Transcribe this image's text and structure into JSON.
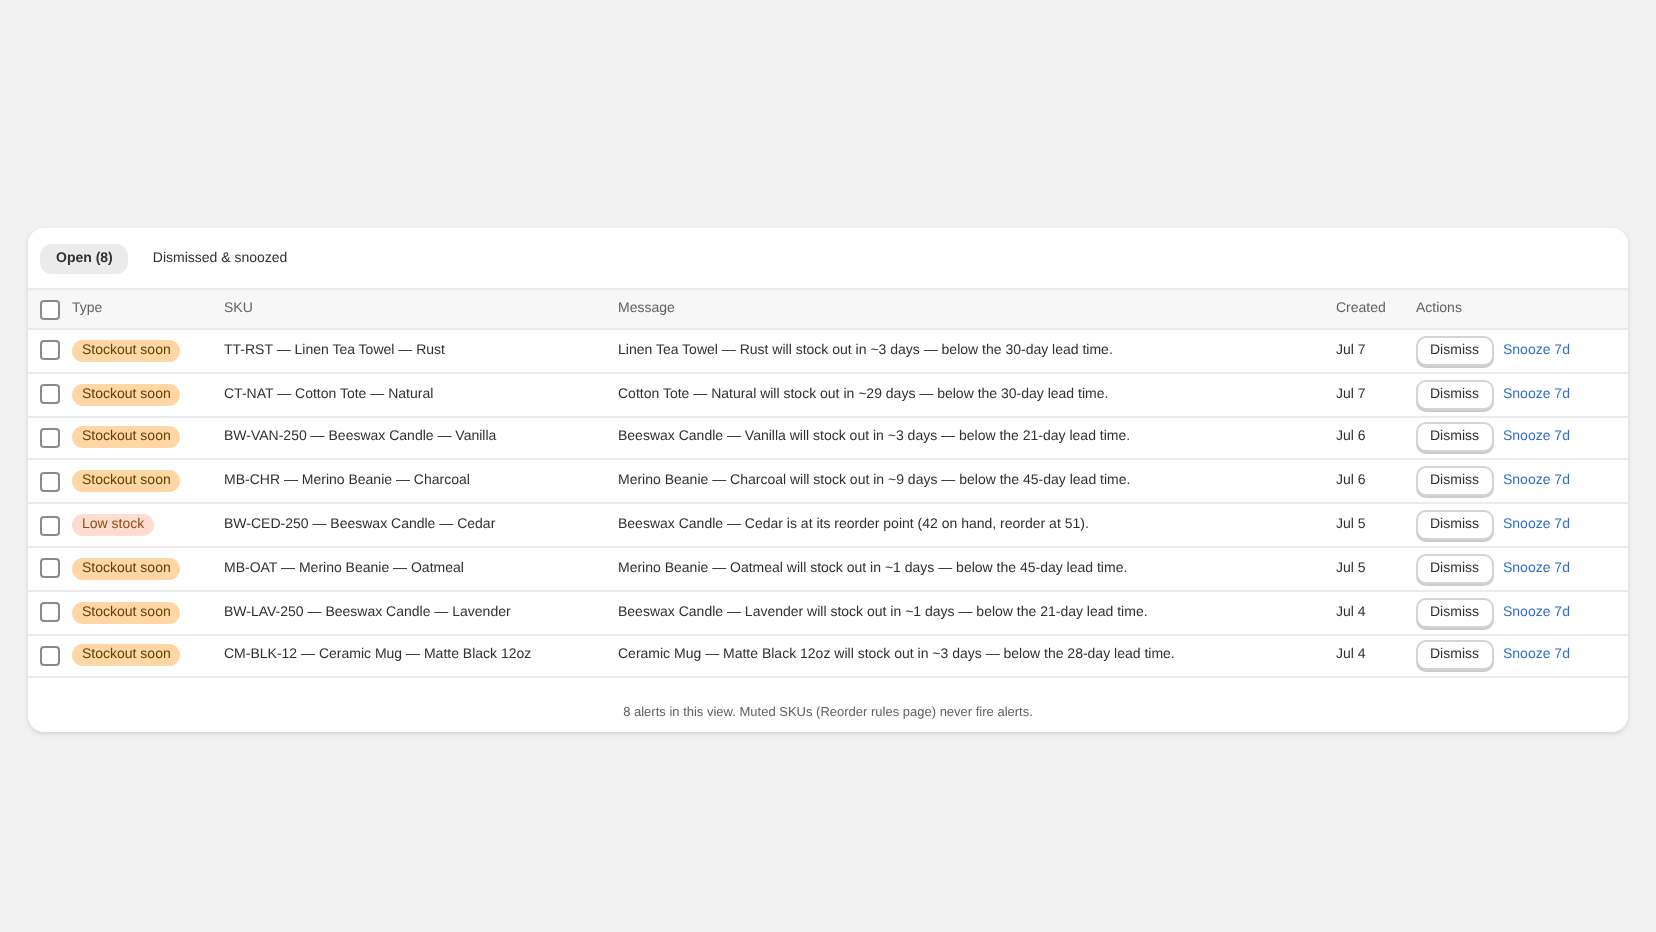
{
  "tabs": [
    {
      "label": "Open (8)",
      "selected": true
    },
    {
      "label": "Dismissed & snoozed",
      "selected": false
    }
  ],
  "table": {
    "select_all_checked": false,
    "columns": [
      "Type",
      "SKU",
      "Message",
      "Created",
      "Actions"
    ],
    "rows": [
      {
        "checked": false,
        "type": {
          "label": "Stockout soon",
          "kind": "stockout"
        },
        "sku": "TT-RST — Linen Tea Towel — Rust",
        "message": "Linen Tea Towel — Rust will stock out in ~3 days — below the 30-day lead time.",
        "created": "Jul 7",
        "actions": [
          "Dismiss",
          "Snooze 7d"
        ]
      },
      {
        "checked": false,
        "type": {
          "label": "Stockout soon",
          "kind": "stockout"
        },
        "sku": "CT-NAT — Cotton Tote — Natural",
        "message": "Cotton Tote — Natural will stock out in ~29 days — below the 30-day lead time.",
        "created": "Jul 7",
        "actions": [
          "Dismiss",
          "Snooze 7d"
        ]
      },
      {
        "checked": false,
        "type": {
          "label": "Stockout soon",
          "kind": "stockout"
        },
        "sku": "BW-VAN-250 — Beeswax Candle — Vanilla",
        "message": "Beeswax Candle — Vanilla will stock out in ~3 days — below the 21-day lead time.",
        "created": "Jul 6",
        "actions": [
          "Dismiss",
          "Snooze 7d"
        ]
      },
      {
        "checked": false,
        "type": {
          "label": "Stockout soon",
          "kind": "stockout"
        },
        "sku": "MB-CHR — Merino Beanie — Charcoal",
        "message": "Merino Beanie — Charcoal will stock out in ~9 days — below the 45-day lead time.",
        "created": "Jul 6",
        "actions": [
          "Dismiss",
          "Snooze 7d"
        ]
      },
      {
        "checked": false,
        "type": {
          "label": "Low stock",
          "kind": "low"
        },
        "sku": "BW-CED-250 — Beeswax Candle — Cedar",
        "message": "Beeswax Candle — Cedar is at its reorder point (42 on hand, reorder at 51).",
        "created": "Jul 5",
        "actions": [
          "Dismiss",
          "Snooze 7d"
        ]
      },
      {
        "checked": false,
        "type": {
          "label": "Stockout soon",
          "kind": "stockout"
        },
        "sku": "MB-OAT — Merino Beanie — Oatmeal",
        "message": "Merino Beanie — Oatmeal will stock out in ~1 days — below the 45-day lead time.",
        "created": "Jul 5",
        "actions": [
          "Dismiss",
          "Snooze 7d"
        ]
      },
      {
        "checked": false,
        "type": {
          "label": "Stockout soon",
          "kind": "stockout"
        },
        "sku": "BW-LAV-250 — Beeswax Candle — Lavender",
        "message": "Beeswax Candle — Lavender will stock out in ~1 days — below the 21-day lead time.",
        "created": "Jul 4",
        "actions": [
          "Dismiss",
          "Snooze 7d"
        ]
      },
      {
        "checked": false,
        "type": {
          "label": "Stockout soon",
          "kind": "stockout"
        },
        "sku": "CM-BLK-12 — Ceramic Mug — Matte Black 12oz",
        "message": "Ceramic Mug — Matte Black 12oz will stock out in ~3 days — below the 28-day lead time.",
        "created": "Jul 4",
        "actions": [
          "Dismiss",
          "Snooze 7d"
        ]
      }
    ]
  },
  "footer": "8 alerts in this view. Muted SKUs (Reorder rules page) never fire alerts."
}
